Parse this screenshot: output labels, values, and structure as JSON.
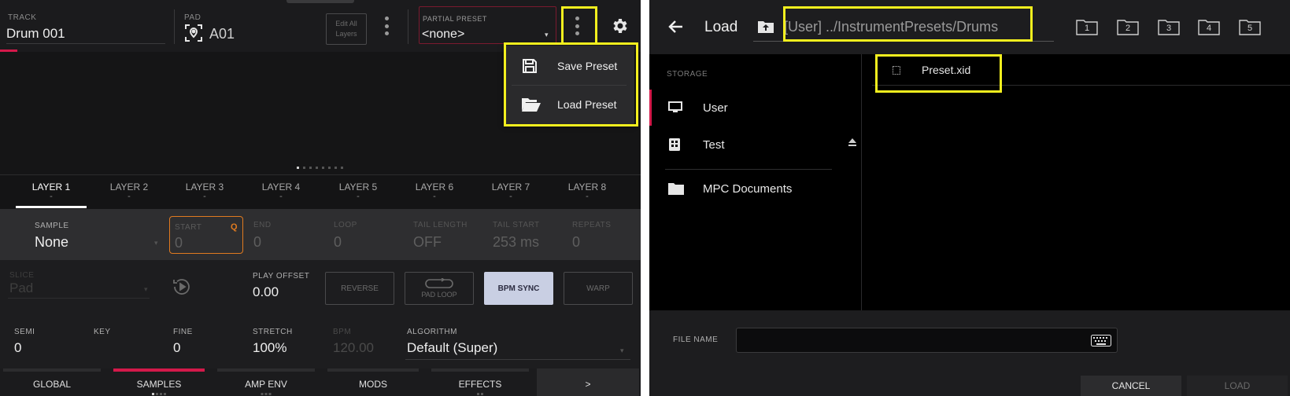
{
  "left": {
    "header": {
      "track_label": "TRACK",
      "track_value": "Drum 001",
      "pad_label": "PAD",
      "pad_value": "A01",
      "edit_all_layers": "Edit All Layers",
      "partial_preset_label": "PARTIAL PRESET",
      "partial_preset_value": "<none>"
    },
    "preset_menu": {
      "items": [
        {
          "label": "Save Preset",
          "icon": "save-icon"
        },
        {
          "label": "Load Preset",
          "icon": "folder-open-icon"
        }
      ]
    },
    "layer_tabs": [
      {
        "label": "LAYER 1",
        "sub": "-"
      },
      {
        "label": "LAYER 2",
        "sub": "-"
      },
      {
        "label": "LAYER 3",
        "sub": "-"
      },
      {
        "label": "LAYER 4",
        "sub": "-"
      },
      {
        "label": "LAYER 5",
        "sub": "-"
      },
      {
        "label": "LAYER 6",
        "sub": "-"
      },
      {
        "label": "LAYER 7",
        "sub": "-"
      },
      {
        "label": "LAYER 8",
        "sub": "-"
      }
    ],
    "sample_row": {
      "sample_label": "SAMPLE",
      "sample_value": "None",
      "start_label": "START",
      "start_value": "0",
      "q_badge": "Q",
      "end_label": "END",
      "end_value": "0",
      "loop_label": "LOOP",
      "loop_value": "0",
      "tail_length_label": "TAIL LENGTH",
      "tail_length_value": "OFF",
      "tail_start_label": "TAIL START",
      "tail_start_value": "253 ms",
      "repeats_label": "REPEATS",
      "repeats_value": "0"
    },
    "params": {
      "slice_label": "SLICE",
      "slice_value": "Pad",
      "play_offset_label": "PLAY OFFSET",
      "play_offset_value": "0.00",
      "reverse": "REVERSE",
      "pad_loop": "PAD LOOP",
      "bpm_sync": "BPM SYNC",
      "warp": "WARP",
      "semi_label": "SEMI",
      "semi_value": "0",
      "key_label": "KEY",
      "fine_label": "FINE",
      "fine_value": "0",
      "stretch_label": "STRETCH",
      "stretch_value": "100%",
      "bpm_label": "BPM",
      "bpm_value": "120.00",
      "algorithm_label": "ALGORITHM",
      "algorithm_value": "Default (Super)"
    },
    "bottom_tabs": [
      {
        "label": "GLOBAL"
      },
      {
        "label": "SAMPLES"
      },
      {
        "label": "AMP ENV"
      },
      {
        "label": "MODS"
      },
      {
        "label": "EFFECTS"
      },
      {
        "label": ">"
      }
    ]
  },
  "right": {
    "header": {
      "title": "Load",
      "path": "[User] ../InstrumentPresets/Drums",
      "folder_buttons": [
        "1",
        "2",
        "3",
        "4",
        "5"
      ]
    },
    "storage": {
      "heading": "STORAGE",
      "items": [
        {
          "label": "User",
          "icon": "monitor-icon"
        },
        {
          "label": "Test",
          "icon": "drive-icon"
        },
        {
          "label": "MPC Documents",
          "icon": "folder-icon"
        }
      ]
    },
    "files": [
      {
        "name": "Preset.xid"
      }
    ],
    "bottom": {
      "file_name_label": "FILE NAME",
      "file_name_value": "",
      "cancel": "CANCEL",
      "load": "LOAD"
    }
  },
  "colors": {
    "accent": "#d4194a",
    "highlight": "#f3ef1e",
    "start_field": "#e07a1f",
    "bpm_sync_on": "#c9cfe3"
  }
}
